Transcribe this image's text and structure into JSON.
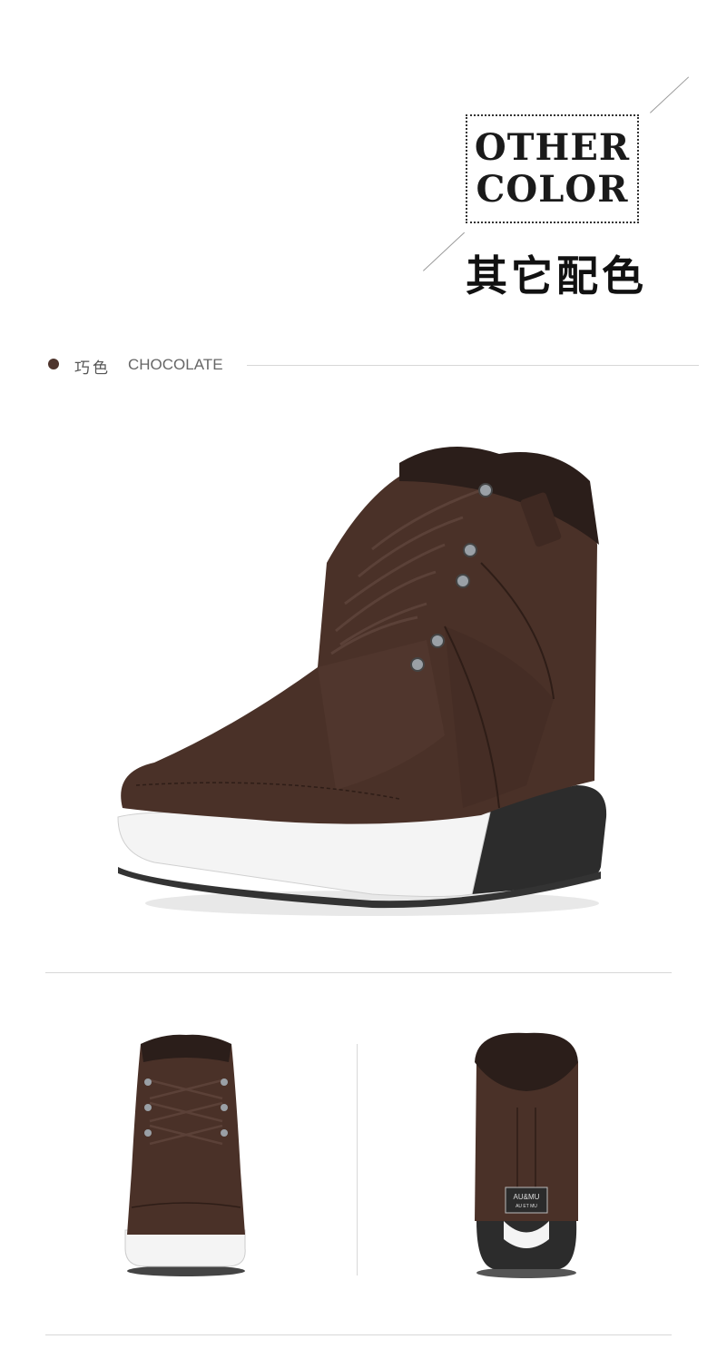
{
  "header": {
    "title_en_line1": "OTHER",
    "title_en_line2": "COLOR",
    "title_cn": "其它配色"
  },
  "color_option": {
    "name_cn": "巧色",
    "name_en": "CHOCOLATE",
    "swatch_color": "#4e352d"
  },
  "product_views": {
    "side": "side-view",
    "front": "front-view",
    "back": "back-view"
  },
  "heel_tag": {
    "brand": "AU&MU",
    "sub": "AU ET MU"
  },
  "colors": {
    "suede": "#4a3128",
    "sole_white": "#f4f4f4",
    "sole_black": "#2c2c2c",
    "accent_line": "#d8d8d8"
  }
}
